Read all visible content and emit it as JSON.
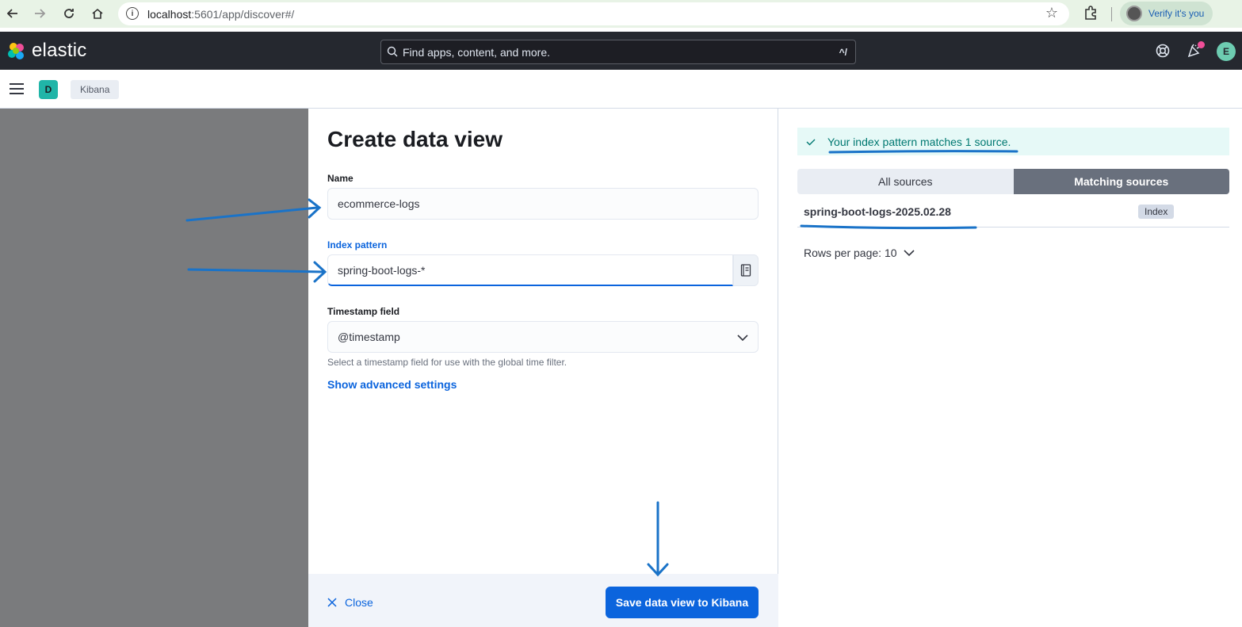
{
  "browser": {
    "url_host": "localhost",
    "url_path": ":5601/app/discover#/",
    "profile_label": "Verify it's you"
  },
  "header": {
    "logo_text": "elastic",
    "search_placeholder": "Find apps, content, and more.",
    "search_shortcut": "^/",
    "user_initial": "E"
  },
  "subheader": {
    "space_initial": "D",
    "breadcrumb": "Kibana"
  },
  "flyout": {
    "title": "Create data view",
    "name_label": "Name",
    "name_value": "ecommerce-logs",
    "index_label": "Index pattern",
    "index_value": "spring-boot-logs-*",
    "timestamp_label": "Timestamp field",
    "timestamp_value": "@timestamp",
    "timestamp_help": "Select a timestamp field for use with the global time filter.",
    "advanced_link": "Show advanced settings",
    "close_label": "Close",
    "save_label": "Save data view to Kibana"
  },
  "sources": {
    "callout": "Your index pattern matches 1 source.",
    "tabs": [
      "All sources",
      "Matching sources"
    ],
    "selected_tab": "Matching sources",
    "rows": [
      {
        "name": "spring-boot-logs-2025.02.28",
        "type": "Index"
      }
    ],
    "rows_per_page": "Rows per page: 10"
  },
  "colors": {
    "primary": "#0b64dd",
    "header_bg": "#25282f",
    "success_text": "#007871",
    "annotation": "#1a73c8"
  }
}
